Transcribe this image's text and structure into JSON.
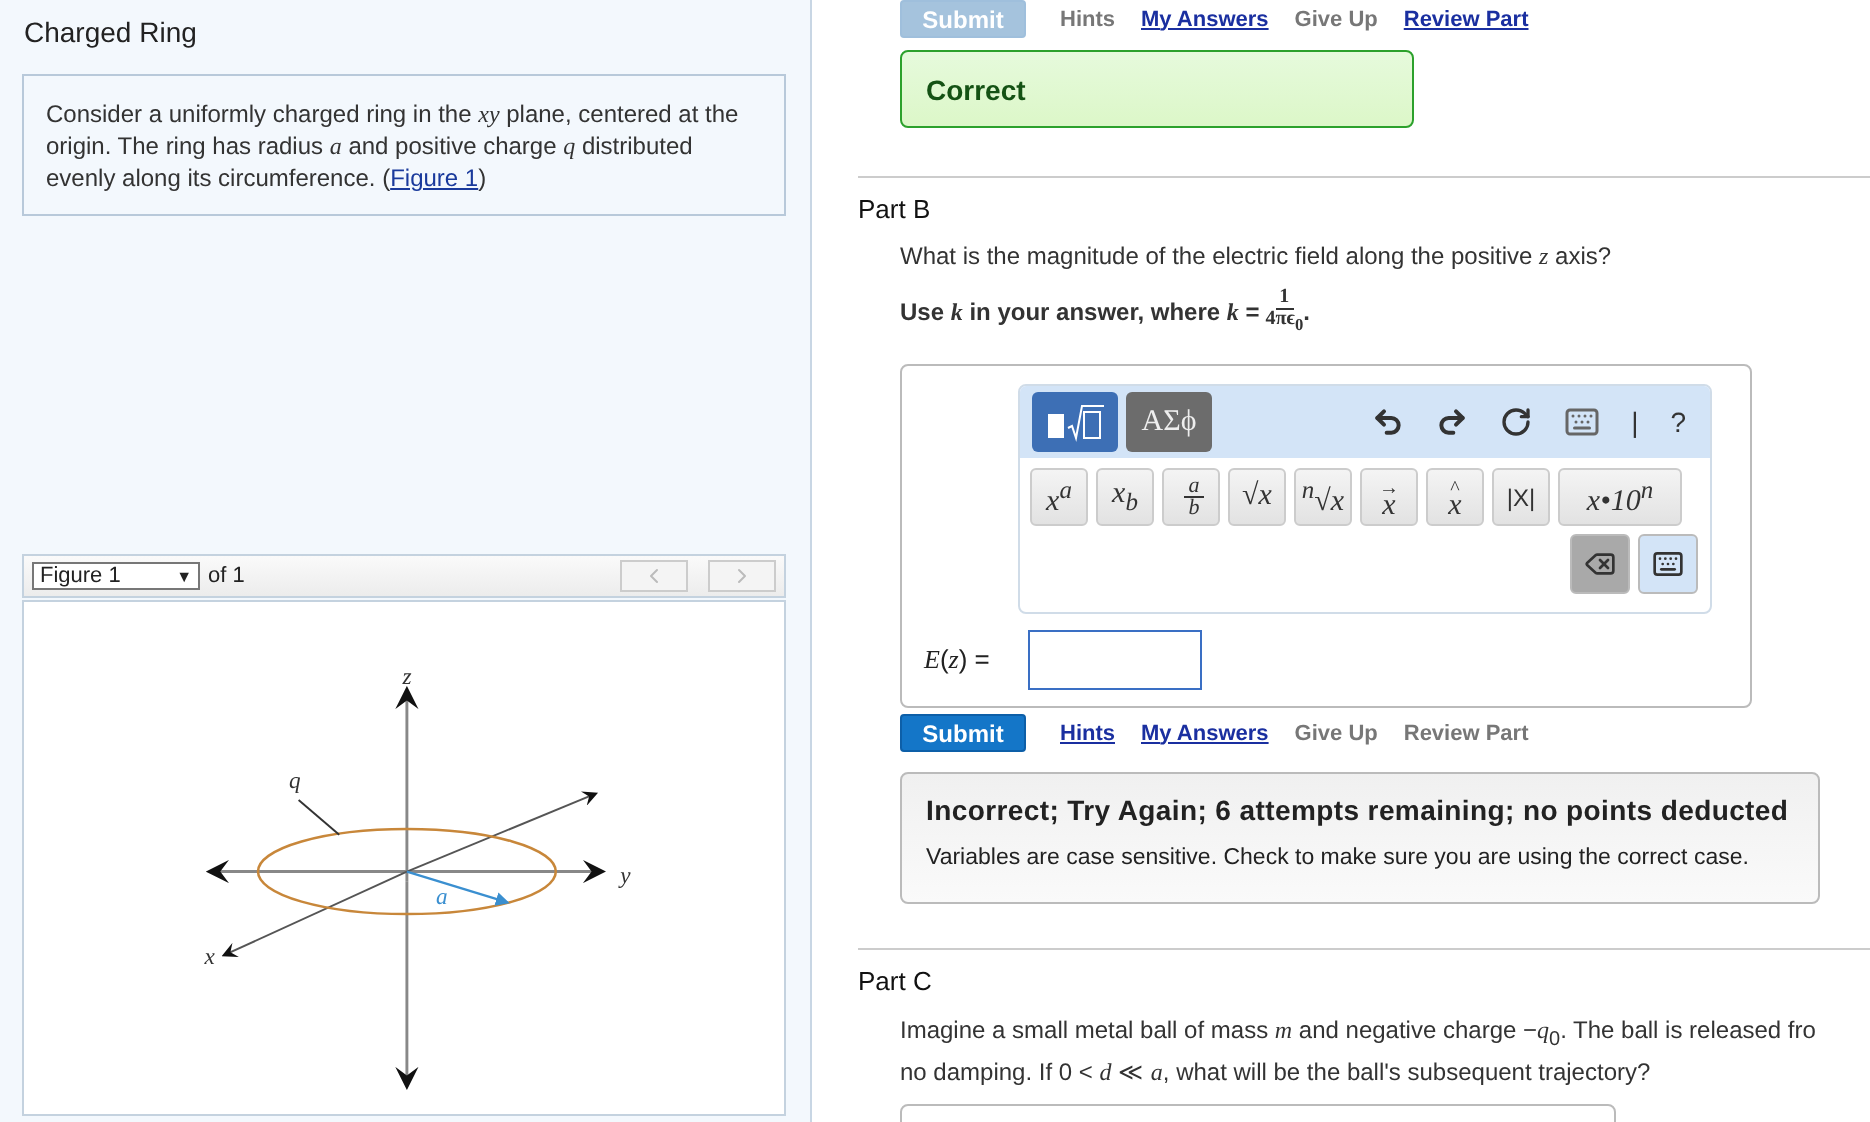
{
  "problem": {
    "title": "Charged Ring",
    "description": {
      "text": "Consider a uniformly charged ring in the *xy* plane, centered at the origin. The ring has radius *a* and positive charge *q* distributed evenly along its circumference. (",
      "link": "Figure 1",
      "after": ")"
    }
  },
  "figure": {
    "select": "Figure 1",
    "select_arrow": "▼",
    "of": "of 1",
    "labels": [
      {
        "kind": "z",
        "text": "z"
      },
      {
        "kind": "q",
        "text": "q"
      },
      {
        "kind": "y",
        "text": "y"
      },
      {
        "kind": "a",
        "text": "a"
      },
      {
        "kind": "x",
        "text": "x"
      }
    ]
  },
  "part_a": {
    "submit": {
      "label": "Submit",
      "disabled": true
    },
    "links": [
      {
        "label": "Hints",
        "enabled": false
      },
      {
        "label": "My Answers",
        "enabled": true
      },
      {
        "label": "Give Up",
        "enabled": false
      },
      {
        "label": "Review Part",
        "enabled": true
      }
    ],
    "feedback": "Correct"
  },
  "part_b": {
    "title": "Part B",
    "question": "What is the magnitude of the electric field along the positive *z* axis?",
    "hint": {
      "text": "Use *k* in your answer, where *k* =",
      "numerator": "1",
      "denominator": "4πϵ$_{0}$",
      "end": "."
    },
    "editor": {
      "tabs": [
        {
          "kind": "templates",
          "selected": true
        },
        {
          "kind": "symbols",
          "label": "ΑΣϕ",
          "selected": false
        }
      ],
      "tools": [
        {
          "kind": "undo"
        },
        {
          "kind": "redo"
        },
        {
          "kind": "reset"
        },
        {
          "kind": "keyboard"
        },
        {
          "kind": "text",
          "label": "|"
        },
        {
          "kind": "text",
          "label": "?"
        }
      ],
      "keys": [
        {
          "kind": "plain",
          "label": "x$^{a}$"
        },
        {
          "kind": "plain",
          "label": "x$_{b}$"
        },
        {
          "kind": "frac",
          "top": "a",
          "bottom": "b"
        },
        {
          "kind": "plain",
          "label": "√x"
        },
        {
          "kind": "plain",
          "label": "$^{n}$√x"
        },
        {
          "kind": "accent",
          "accent": "→",
          "label": "x"
        },
        {
          "kind": "accent",
          "accent": "^",
          "label": "x"
        },
        {
          "kind": "upright",
          "label": "|X|"
        },
        {
          "kind": "wide",
          "label": "x•10$^{n}$"
        }
      ]
    },
    "answer_label": "*E*(*z*) =",
    "submit": {
      "label": "Submit",
      "disabled": false
    },
    "links": [
      {
        "label": "Hints",
        "enabled": true
      },
      {
        "label": "My Answers",
        "enabled": true
      },
      {
        "label": "Give Up",
        "enabled": false
      },
      {
        "label": "Review Part",
        "enabled": false
      }
    ],
    "feedback": {
      "title": "Incorrect; Try Again; 6 attempts remaining; no points deducted",
      "message": "Variables are case sensitive. Check to make sure you are using the correct case."
    }
  },
  "part_c": {
    "title": "Part C",
    "lines": [
      "Imagine a small metal ball of mass *m* and negative charge −*q*$_{0}$. The ball is released fro",
      "no damping. If 0 < *d* ≪ *a*, what will be the ball's subsequent trajectory?"
    ]
  }
}
